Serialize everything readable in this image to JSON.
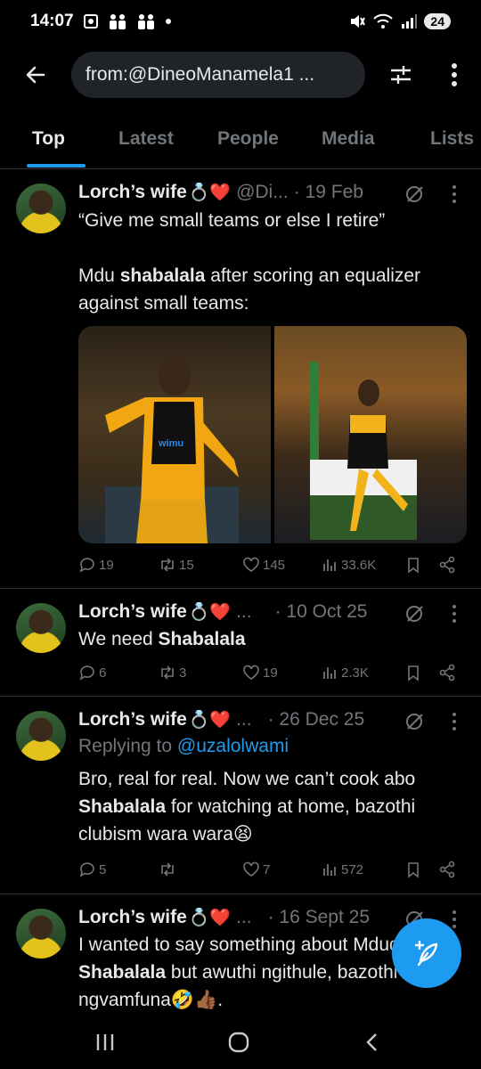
{
  "status_bar": {
    "time": "14:07",
    "battery": "24"
  },
  "header": {
    "search_query": "from:@DineoManamela1 ..."
  },
  "tabs": [
    {
      "label": "Top",
      "active": true
    },
    {
      "label": "Latest",
      "active": false
    },
    {
      "label": "People",
      "active": false
    },
    {
      "label": "Media",
      "active": false
    },
    {
      "label": "Lists",
      "active": false
    }
  ],
  "tweets": [
    {
      "name": "Lorch’s wife",
      "emoji": "💍❤️",
      "handle": "@Di...",
      "date": "· 19 Feb",
      "text_line1": "“Give me small teams or else I retire”",
      "text_p2_before": "Mdu ",
      "text_p2_bold": "shabalala",
      "text_p2_after": " after scoring an equalizer against small teams:",
      "media_jersey": "wimu",
      "stats": {
        "replies": "19",
        "retweets": "15",
        "likes": "145",
        "views": "33.6K"
      }
    },
    {
      "name": "Lorch’s wife",
      "emoji": "💍❤️",
      "handle": "...",
      "date": "· 10 Oct 25",
      "text_before": "We need ",
      "text_bold": "Shabalala",
      "stats": {
        "replies": "6",
        "retweets": "3",
        "likes": "19",
        "views": "2.3K"
      }
    },
    {
      "name": "Lorch’s wife",
      "emoji": "💍❤️",
      "handle": "...",
      "date": "· 26 Dec 25",
      "reply_prefix": "Replying to ",
      "reply_mention": "@uzalolwami",
      "text_before": "Bro, real for real. Now we can’t cook abo ",
      "text_bold": "Shabalala",
      "text_after": " for watching at home, bazothi clubism wara wara😫",
      "stats": {
        "replies": "5",
        "retweets": "",
        "likes": "7",
        "views": "572"
      }
    },
    {
      "name": "Lorch’s wife",
      "emoji": "💍❤️",
      "handle": "...",
      "date": "· 16 Sept 25",
      "text_before": "I wanted to say something about Mduduzi ",
      "text_bold": "Shabalala",
      "text_after": " but awuthi ngithule, bazothi ngvamfuna🤣👍🏾."
    }
  ],
  "colors": {
    "accent": "#1d9bf0",
    "muted": "#71767b",
    "text": "#e7e9ea",
    "divider": "#2f3336"
  }
}
